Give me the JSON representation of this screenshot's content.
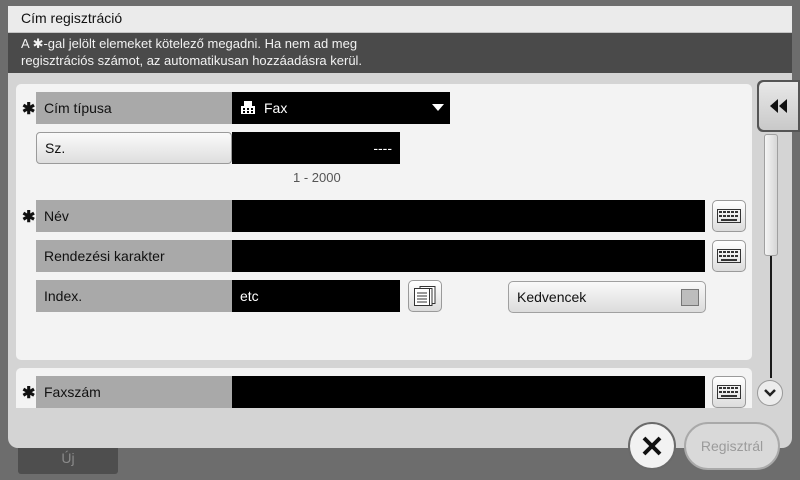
{
  "background_button": {
    "label": "Új"
  },
  "window": {
    "title": "Cím regisztráció",
    "info": "A ✱-gal jelölt elemeket kötelező megadni. Ha nem ad meg\nregisztrációs számot, az automatikusan hozzáadásra kerül."
  },
  "form": {
    "address_type": {
      "label": "Cím típusa",
      "value": "Fax",
      "icon": "fax-icon",
      "required": true
    },
    "number": {
      "label": "Sz.",
      "value": "----",
      "range": "1 - 2000"
    },
    "name": {
      "label": "Név",
      "value": "",
      "required": true
    },
    "sort_char": {
      "label": "Rendezési karakter",
      "value": ""
    },
    "index": {
      "label": "Index.",
      "value": "etc"
    },
    "favorites": {
      "label": "Kedvencek",
      "checked": false
    },
    "fax_number": {
      "label": "Faxszám",
      "value": "",
      "required": true
    }
  },
  "required_marker": "✱",
  "footer": {
    "register_label": "Regisztrál",
    "register_enabled": false
  },
  "colors": {
    "field_bg": "#000000",
    "label_bg": "#a9a9a9",
    "info_bar": "#4a4a4a"
  }
}
